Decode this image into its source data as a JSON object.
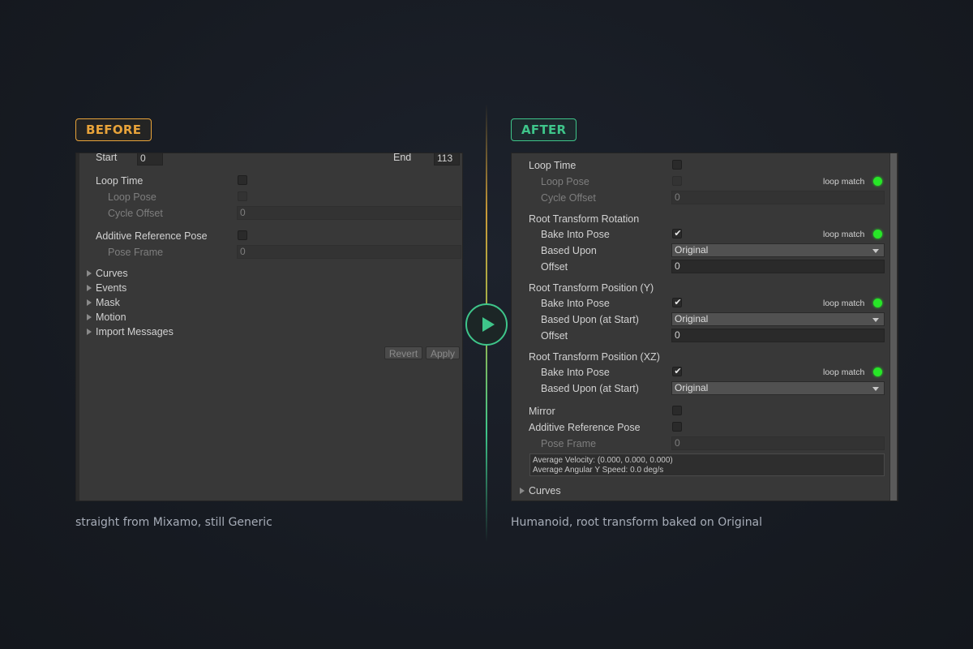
{
  "before": {
    "tag": "BEFORE",
    "caption": "straight from Mixamo, still Generic",
    "start_label": "Start",
    "start_value": "0",
    "end_label": "End",
    "end_value": "113",
    "loop_time": "Loop Time",
    "loop_pose": "Loop Pose",
    "cycle_offset": "Cycle Offset",
    "cycle_offset_value": "0",
    "additive_reference_pose": "Additive Reference Pose",
    "pose_frame": "Pose Frame",
    "pose_frame_value": "0",
    "foldouts": [
      "Curves",
      "Events",
      "Mask",
      "Motion",
      "Import Messages"
    ],
    "revert": "Revert",
    "apply": "Apply"
  },
  "after": {
    "tag": "AFTER",
    "caption": "Humanoid, root transform baked on Original",
    "loop_time": "Loop Time",
    "loop_pose": "Loop Pose",
    "cycle_offset": "Cycle Offset",
    "cycle_offset_value": "0",
    "loop_match": "loop match",
    "rotation": {
      "heading": "Root Transform Rotation",
      "bake": "Bake Into Pose",
      "based_upon": "Based Upon",
      "based_upon_value": "Original",
      "offset": "Offset",
      "offset_value": "0"
    },
    "position_y": {
      "heading": "Root Transform Position (Y)",
      "bake": "Bake Into Pose",
      "based_upon": "Based Upon (at Start)",
      "based_upon_value": "Original",
      "offset": "Offset",
      "offset_value": "0"
    },
    "position_xz": {
      "heading": "Root Transform Position (XZ)",
      "bake": "Bake Into Pose",
      "based_upon": "Based Upon (at Start)",
      "based_upon_value": "Original"
    },
    "mirror": "Mirror",
    "additive_reference_pose": "Additive Reference Pose",
    "pose_frame": "Pose Frame",
    "pose_frame_value": "0",
    "average_velocity": "Average Velocity: (0.000, 0.000, 0.000)",
    "average_angular": "Average Angular Y Speed: 0.0 deg/s",
    "curves": "Curves"
  },
  "colors": {
    "before_accent": "#e8a33a",
    "after_accent": "#3ec58a",
    "loop_match_indicator": "#27e627"
  },
  "icons": [
    "play-icon",
    "checkmark-icon",
    "foldout-arrow-icon",
    "dropdown-arrow-icon"
  ]
}
